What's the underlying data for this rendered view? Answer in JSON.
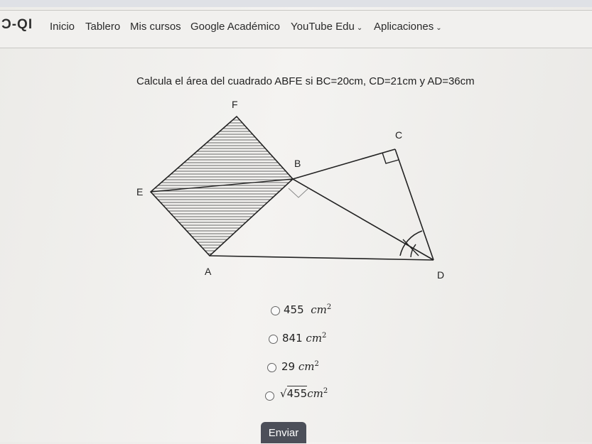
{
  "logo": {
    "text": "Ɔ-QI"
  },
  "nav": {
    "items": [
      {
        "label": "Inicio"
      },
      {
        "label": "Tablero"
      },
      {
        "label": "Mis cursos"
      },
      {
        "label": "Google Académico"
      },
      {
        "label": "YouTube Edu"
      },
      {
        "label": "Aplicaciones"
      }
    ]
  },
  "question": {
    "text": "Calcula el área del cuadrado ABFE si BC=20cm, CD=21cm y AD=36cm"
  },
  "figure": {
    "labels": {
      "F": "F",
      "C": "C",
      "B": "B",
      "E": "E",
      "A": "A",
      "D": "D"
    }
  },
  "options": [
    {
      "value": "455",
      "unit": "cm",
      "exp": "2"
    },
    {
      "value": "841",
      "unit": "cm",
      "exp": "2"
    },
    {
      "value": "29",
      "unit": "cm",
      "exp": "2"
    },
    {
      "value": "√",
      "radicand": "455",
      "unit": "cm",
      "exp": "2"
    }
  ],
  "submit": {
    "label": "Enviar"
  }
}
